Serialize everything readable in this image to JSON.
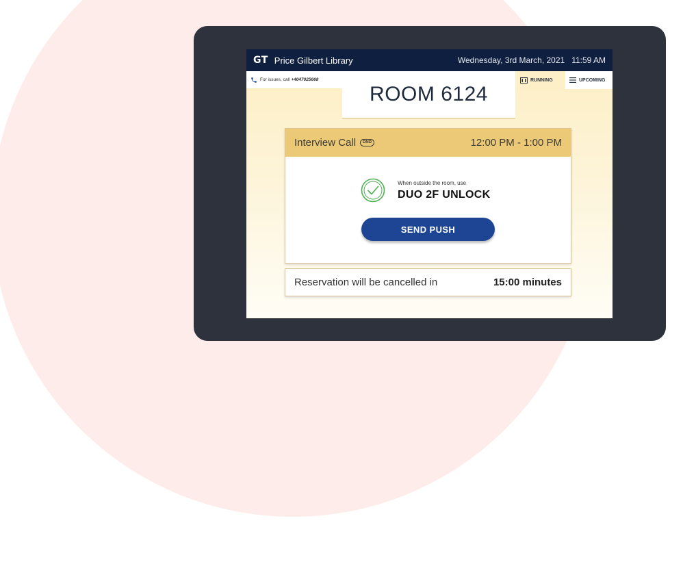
{
  "header": {
    "brand": "GT",
    "library": "Price Gilbert Library",
    "date": "Wednesday, 3rd March, 2021",
    "time": "11:59 AM"
  },
  "help": {
    "text": "For issues, call",
    "phone": "+4047025668",
    "icon": "phone-icon"
  },
  "room": {
    "title": "ROOM 6124"
  },
  "tabs": [
    {
      "label": "RUNNING",
      "icon": "running-icon"
    },
    {
      "label": "UPCOMING",
      "icon": "list-icon"
    }
  ],
  "meeting": {
    "title": "Interview Call",
    "badge": "DND",
    "time_range": "12:00 PM - 1:00 PM",
    "unlock_hint": "When outside the room, use",
    "unlock_title": "DUO 2F UNLOCK",
    "button_label": "SEND PUSH"
  },
  "cancel": {
    "label": "Reservation will be cancelled in",
    "value": "15:00 minutes"
  },
  "colors": {
    "topbar": "#0f1f3f",
    "header_gold": "#ecc976",
    "button_blue": "#1d4594",
    "check_green": "#4caf50",
    "tablet_frame": "#2e323d",
    "bg_circle": "#fdece9"
  }
}
